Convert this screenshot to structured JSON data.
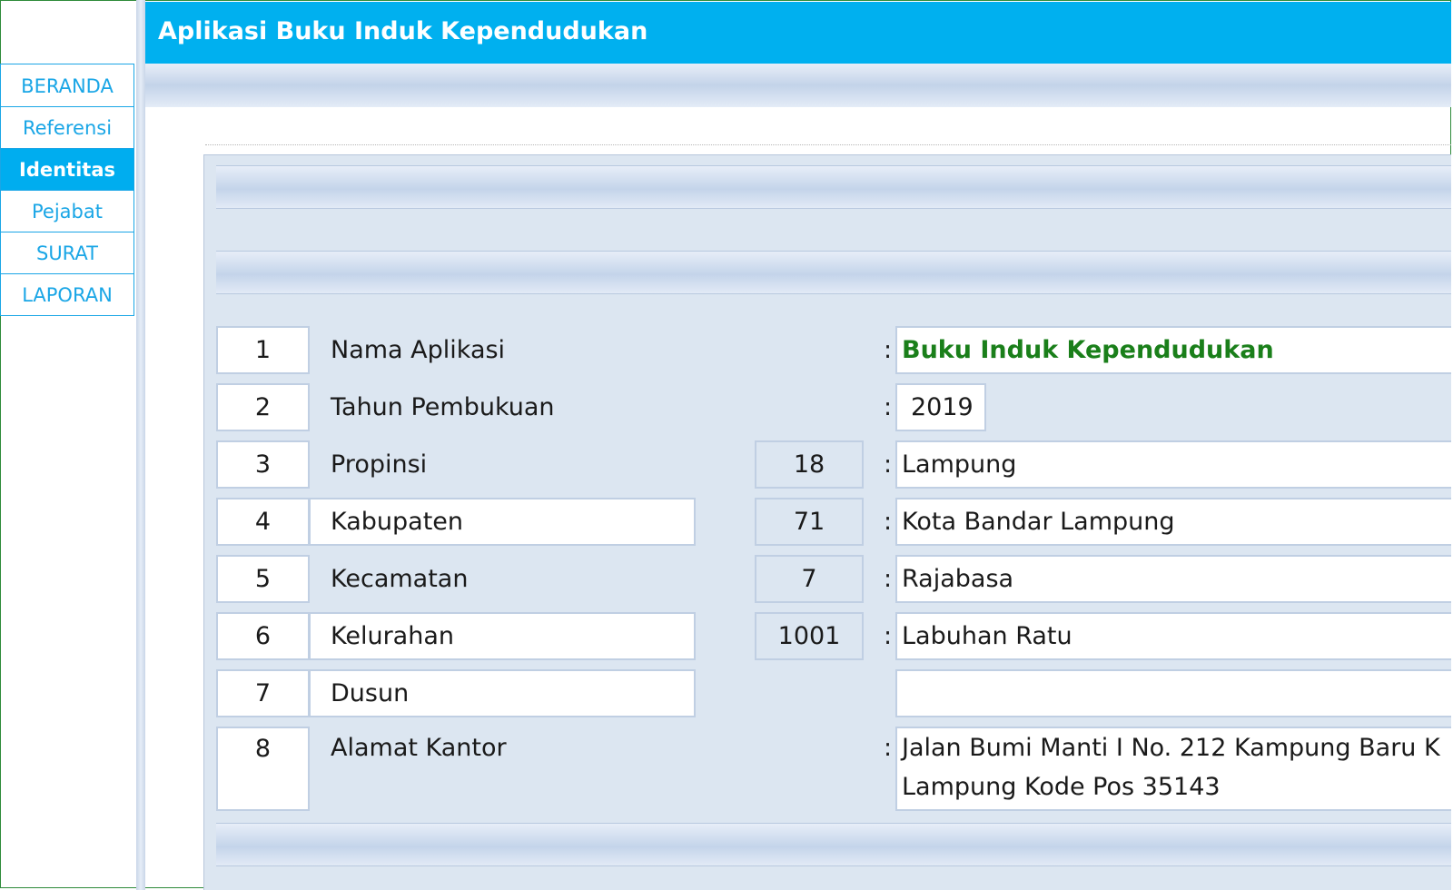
{
  "app": {
    "title": "Aplikasi Buku Induk Kependudukan"
  },
  "nav": {
    "items": [
      "BERANDA",
      "Referensi",
      "Identitas",
      "Pejabat",
      "SURAT",
      "LAPORAN"
    ],
    "active": "Identitas"
  },
  "rows": [
    {
      "no": "1",
      "label": "Nama Aplikasi",
      "code": "",
      "value": "Buku Induk Kependudukan"
    },
    {
      "no": "2",
      "label": "Tahun Pembukuan",
      "code": "",
      "value": "2019"
    },
    {
      "no": "3",
      "label": "Propinsi",
      "code": "18",
      "value": "Lampung"
    },
    {
      "no": "4",
      "label": "Kabupaten",
      "code": "71",
      "value": "Kota Bandar Lampung"
    },
    {
      "no": "5",
      "label": "Kecamatan",
      "code": "7",
      "value": "Rajabasa"
    },
    {
      "no": "6",
      "label": "Kelurahan",
      "code": "1001",
      "value": "Labuhan Ratu"
    },
    {
      "no": "7",
      "label": "Dusun",
      "code": "",
      "value": ""
    },
    {
      "no": "8",
      "label": "Alamat Kantor",
      "code": "",
      "value_line1": "Jalan Bumi Manti I No. 212 Kampung Baru K",
      "value_line2": "Lampung Kode Pos 35143"
    }
  ],
  "colon": ":",
  "colors": {
    "accent": "#00adef",
    "panel": "#dce6f1",
    "green_value": "#1a7f1a"
  }
}
